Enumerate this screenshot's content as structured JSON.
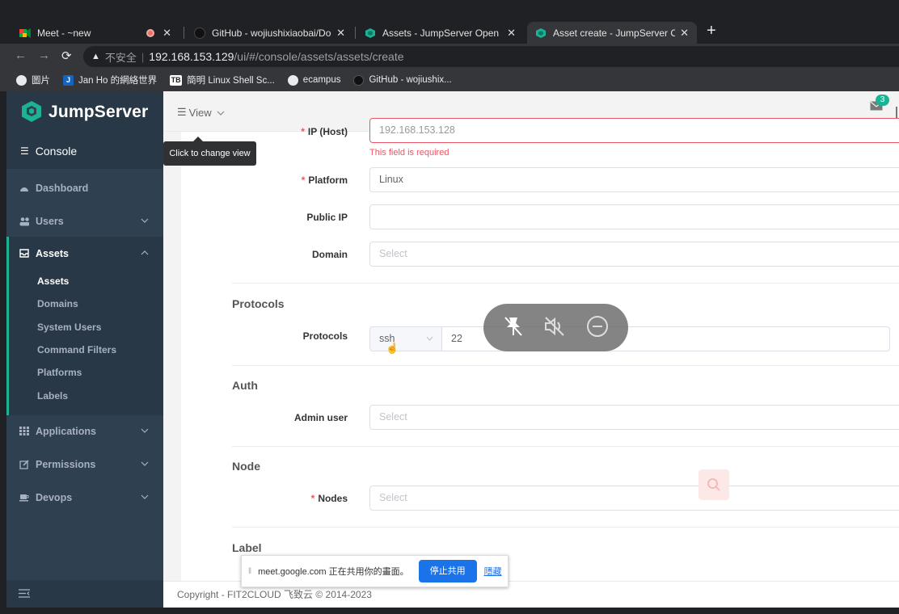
{
  "tabs": [
    {
      "title": "Meet - ~new",
      "recording": true
    },
    {
      "title": "GitHub - wojiushixiaobai/Dock"
    },
    {
      "title": "Assets - JumpServer Open Sou"
    },
    {
      "title": "Asset create - JumpServer Ope",
      "active": true
    }
  ],
  "address": {
    "security": "不安全",
    "host": "192.168.153.129",
    "path": "/ui/#/console/assets/assets/create"
  },
  "bookmarks": [
    "圖片",
    "Jan Ho 的網絡世界",
    "簡明 Linux Shell Sc...",
    "ecampus",
    "GitHub - wojiushix..."
  ],
  "sidebar": {
    "brand": "JumpServer",
    "console": "Console",
    "items": [
      {
        "label": "Dashboard"
      },
      {
        "label": "Users"
      },
      {
        "label": "Assets"
      },
      {
        "label": "Applications"
      },
      {
        "label": "Permissions"
      },
      {
        "label": "Devops"
      }
    ],
    "asset_sub": [
      "Assets",
      "Domains",
      "System Users",
      "Command Filters",
      "Platforms",
      "Labels"
    ]
  },
  "topnav": {
    "view_label": "View",
    "tooltip": "Click to change view",
    "mail_count": "3"
  },
  "form": {
    "ip_label": "IP (Host)",
    "ip_value": "192.168.153.128",
    "ip_error": "This field is required",
    "platform_label": "Platform",
    "platform_value": "Linux",
    "publicip_label": "Public IP",
    "domain_label": "Domain",
    "select_placeholder": "Select",
    "sec_protocols": "Protocols",
    "protocols_label": "Protocols",
    "protocol_name": "ssh",
    "protocol_port": "22",
    "sec_auth": "Auth",
    "admin_label": "Admin user",
    "sec_node": "Node",
    "nodes_label": "Nodes",
    "sec_label": "Label"
  },
  "footer": "Copyright - FIT2CLOUD 飞致云 © 2014-2023",
  "meet_share": {
    "text": "meet.google.com 正在共用你的畫面。",
    "stop": "停止共用",
    "hide": "隱藏"
  },
  "colors": {
    "sidebar": "#2f4050",
    "accent": "#1ab394",
    "error": "#ed5565",
    "link": "#1a73e8"
  }
}
